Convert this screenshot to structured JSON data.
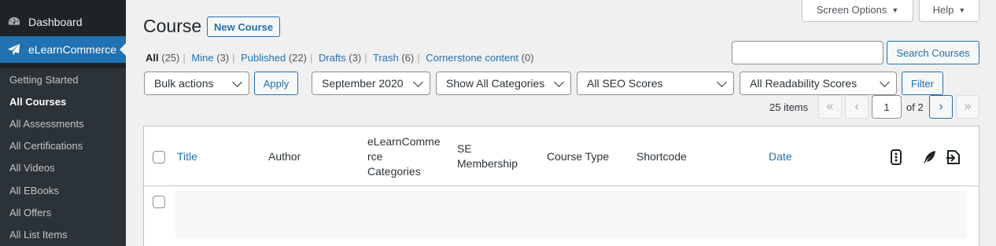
{
  "sidebar": {
    "dashboard_label": "Dashboard",
    "plugin_label": "eLearnCommerce",
    "submenu": [
      {
        "label": "Getting Started"
      },
      {
        "label": "All Courses"
      },
      {
        "label": "All Assessments"
      },
      {
        "label": "All Certifications"
      },
      {
        "label": "All Videos"
      },
      {
        "label": "All EBooks"
      },
      {
        "label": "All Offers"
      },
      {
        "label": "All List Items"
      }
    ],
    "current_item": "All Courses"
  },
  "top": {
    "screen_options": "Screen Options",
    "help": "Help"
  },
  "header": {
    "title": "Course",
    "new_button": "New Course"
  },
  "views": [
    {
      "label": "All",
      "count": "(25)"
    },
    {
      "label": "Mine",
      "count": "(3)"
    },
    {
      "label": "Published",
      "count": "(22)"
    },
    {
      "label": "Drafts",
      "count": "(3)"
    },
    {
      "label": "Trash",
      "count": "(6)"
    },
    {
      "label": "Cornerstone content",
      "count": "(0)"
    }
  ],
  "search": {
    "value": "",
    "button": "Search Courses"
  },
  "filters": {
    "bulk_actions": "Bulk actions",
    "apply": "Apply",
    "date": "September 2020",
    "categories": "Show All Categories",
    "seo": "All SEO Scores",
    "readability": "All Readability Scores",
    "filter_button": "Filter"
  },
  "pagination": {
    "items": "25 items",
    "first": "«",
    "prev": "‹",
    "current_page": "1",
    "of": "of 2",
    "next": "›",
    "last": "»"
  },
  "table": {
    "columns": {
      "title": "Title",
      "author": "Author",
      "categories_line1": "eLearnComme",
      "categories_line2": "rce",
      "categories_line3": "Categories",
      "membership_line1": "SE",
      "membership_line2": "Membership",
      "course_type": "Course Type",
      "shortcode": "Shortcode",
      "date": "Date"
    },
    "icon_columns": [
      "comments-icon",
      "seo-feather-icon",
      "links-icon"
    ]
  },
  "colors": {
    "accent": "#2271b1",
    "sidebar_bg": "#1d2327",
    "submenu_bg": "#2c3338",
    "page_bg": "#f0f0f1"
  }
}
